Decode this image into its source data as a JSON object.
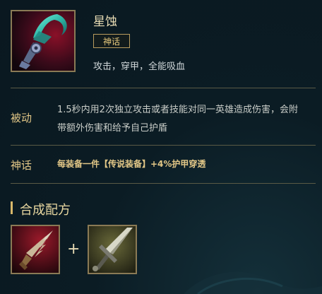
{
  "item": {
    "name": "星蚀",
    "badge": "神话",
    "tags": "攻击，穿甲，全能吸血",
    "icon": "eclipse-scythe-icon"
  },
  "passive": {
    "label": "被动",
    "text_line1": "1.5秒内用2次独立攻击或者技能对同一英雄造成伤害，会附",
    "text_line2": "带额外伤害和给予自己护盾"
  },
  "mythic": {
    "label": "神话",
    "text": "每装备一件【传说装备】+4%护甲穿透"
  },
  "recipe": {
    "title": "合成配方",
    "plus": "+",
    "components": [
      {
        "icon": "serrated-dirk-icon"
      },
      {
        "icon": "long-sword-icon"
      }
    ]
  },
  "colors": {
    "background": "#0b1a22",
    "gold_text": "#e2c787",
    "frame": "#8a7a55",
    "divider": "#5a5a45"
  }
}
